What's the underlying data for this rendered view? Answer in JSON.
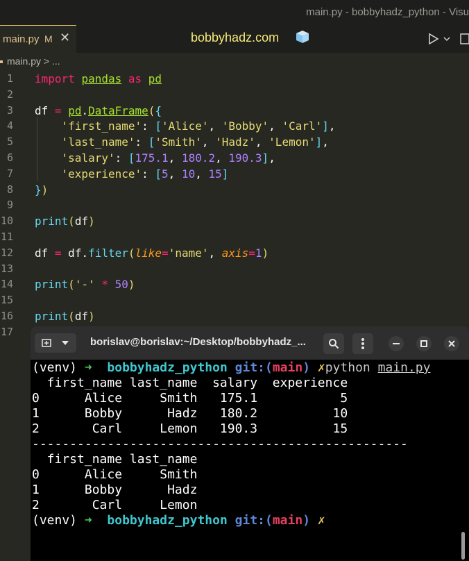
{
  "window": {
    "title": "main.py - bobbyhadz_python - Visu"
  },
  "tab": {
    "name": "main.py",
    "modified": "M",
    "close": "✕"
  },
  "brand": "bobbyhadz.com",
  "breadcrumb": {
    "file": "main.py",
    "sep": ">",
    "rest": "..."
  },
  "editor": {
    "line_numbers": [
      "1",
      "2",
      "3",
      "4",
      "5",
      "6",
      "7",
      "8",
      "9",
      "10",
      "11",
      "12",
      "13",
      "14",
      "15",
      "16",
      "17"
    ],
    "lines": [
      "import pandas as pd",
      "",
      "df = pd.DataFrame({",
      "    'first_name': ['Alice', 'Bobby', 'Carl'],",
      "    'last_name': ['Smith', 'Hadz', 'Lemon'],",
      "    'salary': [175.1, 180.2, 190.3],",
      "    'experience': [5, 10, 15]",
      "})",
      "",
      "print(df)",
      "",
      "df = df.filter(like='name', axis=1)",
      "",
      "print('-' * 50)",
      "",
      "print(df)",
      ""
    ]
  },
  "terminal": {
    "title": "borislav@borislav:~/Desktop/bobbyhadz_...",
    "prompt": {
      "venv": "(venv)",
      "arrow": "➜",
      "dir": "bobbyhadz_python",
      "git": "git:(",
      "branch": "main",
      "git_close": ")",
      "dirty": "✗"
    },
    "command": {
      "cmd": "python",
      "file": "main.py"
    },
    "output": [
      "  first_name last_name  salary  experience",
      "0      Alice     Smith   175.1           5",
      "1      Bobby      Hadz   180.2          10",
      "2       Carl     Lemon   190.3          15",
      "--------------------------------------------------",
      "  first_name last_name",
      "0      Alice     Smith",
      "1      Bobby      Hadz",
      "2       Carl     Lemon"
    ]
  },
  "colors": {
    "editor_bg": "#272822",
    "terminal_bg": "#000000",
    "accent": "#f0c674"
  }
}
